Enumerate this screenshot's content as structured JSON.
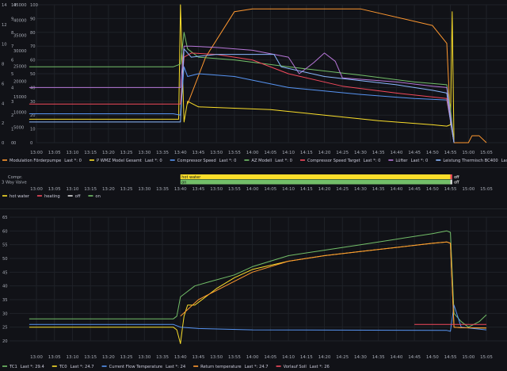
{
  "chart_data": [
    {
      "type": "line",
      "panel": "heat-pump-power-modulation",
      "time_ticks": [
        "13:00",
        "13:05",
        "13:10",
        "13:15",
        "13:20",
        "13:25",
        "13:30",
        "13:35",
        "13:40",
        "13:45",
        "13:50",
        "13:55",
        "14:00",
        "14:05",
        "14:10",
        "14:15",
        "14:20",
        "14:25",
        "14:30",
        "14:35",
        "14:40",
        "14:45",
        "14:50",
        "14:55",
        "15:00",
        "15:05"
      ],
      "y_axes": [
        {
          "ticks": [
            0,
            2,
            4,
            6,
            8,
            10,
            12,
            14
          ]
        },
        {
          "ticks": [
            0,
            1,
            2,
            3,
            4,
            5,
            6,
            7,
            8,
            9,
            10
          ]
        },
        {
          "ticks": [
            0,
            5000,
            10000,
            15000,
            20000,
            25000,
            30000,
            35000,
            40000,
            45000
          ]
        },
        {
          "ticks": [
            0,
            10,
            20,
            30,
            40,
            50,
            60,
            70,
            80,
            90,
            100
          ]
        }
      ],
      "y_axis_labels": [
        [
          "0",
          "2",
          "4",
          "6",
          "8",
          "10",
          "12",
          "14"
        ],
        [
          "0",
          "1",
          "2",
          "3",
          "4",
          "5",
          "6",
          "7",
          "8",
          "9",
          "10"
        ],
        [
          "0",
          "5000",
          "10000",
          "15000",
          "20000",
          "25000",
          "30000",
          "35000",
          "40000",
          "45000"
        ],
        [
          "0",
          "10",
          "20",
          "30",
          "40",
          "50",
          "60",
          "70",
          "80",
          "90",
          "100"
        ]
      ],
      "plot_y_max": 100,
      "legend_placement": "bottom",
      "series": [
        {
          "name": "Modulation Förderpumpe",
          "last": "Last *: 0",
          "color": "#ff9830",
          "x": [
            "12:58",
            "13:40",
            "13:42",
            "13:47",
            "13:55",
            "14:00",
            "14:30",
            "14:50",
            "14:54",
            "14:55",
            "14:56",
            "15:00",
            "15:01",
            "15:03",
            "15:05"
          ],
          "y": [
            null,
            null,
            28,
            62,
            95,
            97,
            97,
            85,
            72,
            15,
            0,
            0,
            5,
            5,
            0
          ]
        },
        {
          "name": "P WMZ Model Gesamt",
          "last": "Last *: 0",
          "color": "#fade2a",
          "x": [
            "12:58",
            "13:38",
            "13:39.5",
            "13:40",
            "13:41",
            "13:42",
            "13:45",
            "13:55",
            "14:05",
            "14:20",
            "14:35",
            "14:50",
            "14:54",
            "14:55",
            "14:55.5",
            "14:56"
          ],
          "y": [
            17,
            17,
            17,
            100,
            15,
            30,
            26,
            25,
            24,
            20,
            16,
            13,
            12,
            13,
            95,
            0
          ]
        },
        {
          "name": "Compressor Speed",
          "last": "Last *: 0",
          "color": "#5794f2",
          "x": [
            "12:58",
            "13:38",
            "13:40",
            "13:41",
            "13:42",
            "13:45",
            "13:55",
            "14:10",
            "14:30",
            "14:45",
            "14:54",
            "14:55",
            "14:56"
          ],
          "y": [
            21,
            21,
            20,
            55,
            48,
            50,
            48,
            40,
            35,
            32,
            31,
            16,
            0
          ]
        },
        {
          "name": "AZ Modell",
          "last": "Last *: 0",
          "color": "#73bf69",
          "x": [
            "12:58",
            "13:38",
            "13:40",
            "13:41",
            "13:42",
            "13:45",
            "13:55",
            "14:10",
            "14:30",
            "14:45",
            "14:54",
            "14:55",
            "14:56"
          ],
          "y": [
            55,
            55,
            57,
            80,
            68,
            62,
            60,
            55,
            49,
            44,
            42,
            25,
            0
          ]
        },
        {
          "name": "Compressor Speed Target",
          "last": "Last *: 0",
          "color": "#f2495c",
          "x": [
            "12:58",
            "13:38",
            "13:40",
            "13:41",
            "13:43",
            "13:50",
            "14:00",
            "14:10",
            "14:25",
            "14:40",
            "14:54",
            "14:55",
            "14:56"
          ],
          "y": [
            28,
            28,
            28,
            62,
            65,
            64,
            60,
            50,
            41,
            36,
            32,
            16,
            0
          ]
        },
        {
          "name": "Lüfter",
          "last": "Last *: 0",
          "color": "#b877d9",
          "x": [
            "12:58",
            "13:38",
            "13:40",
            "13:41",
            "13:43",
            "13:50",
            "14:00",
            "14:10",
            "14:13",
            "14:17",
            "14:20",
            "14:23",
            "14:25",
            "14:40",
            "14:50",
            "14:54",
            "14:55",
            "14:56"
          ],
          "y": [
            40,
            40,
            40,
            70,
            70,
            69,
            67,
            62,
            50,
            58,
            65,
            59,
            47,
            44,
            41,
            40,
            20,
            0
          ]
        },
        {
          "name": "Leistung Thermisch BC400",
          "last": "Last *: 0",
          "color": "#8ab8ff",
          "x": [
            "12:58",
            "13:38",
            "13:40",
            "13:41",
            "13:43",
            "13:50",
            "14:00",
            "14:06",
            "14:08",
            "14:20",
            "14:40",
            "14:50",
            "14:54",
            "14:55",
            "14:56"
          ],
          "y": [
            15,
            15,
            15,
            68,
            62,
            64,
            64,
            64,
            55,
            48,
            42,
            38,
            36,
            16,
            0
          ]
        }
      ]
    },
    {
      "type": "state-timeline",
      "panel": "compressor-valve",
      "time_ticks": [
        "13:00",
        "13:05",
        "13:10",
        "13:15",
        "13:20",
        "13:25",
        "13:30",
        "13:35",
        "13:40",
        "13:45",
        "13:50",
        "13:55",
        "14:00",
        "14:05",
        "14:10",
        "14:15",
        "14:20",
        "14:25",
        "14:30",
        "14:35",
        "14:40",
        "14:45",
        "14:50",
        "14:55",
        "15:00",
        "15:05"
      ],
      "rows": [
        {
          "name": "Compr.",
          "segments": [
            {
              "from": "13:40",
              "to": "14:55",
              "label": "hot water",
              "color": "#fade2a"
            },
            {
              "from": "14:55",
              "to": "14:55.5",
              "label": "",
              "color": "#f2495c"
            }
          ],
          "end_label": "off"
        },
        {
          "name": "3 Way Valve",
          "segments": [
            {
              "from": "13:40",
              "to": "14:55",
              "label": "on",
              "color": "#73bf69"
            },
            {
              "from": "14:55",
              "to": "14:55.5",
              "label": "",
              "color": "#e0e0e0"
            }
          ],
          "end_label": "off"
        }
      ],
      "legend": [
        {
          "name": "hot water",
          "color": "#fade2a"
        },
        {
          "name": "heating",
          "color": "#f2495c"
        },
        {
          "name": "off",
          "color": "#e0e0e0"
        },
        {
          "name": "on",
          "color": "#73bf69"
        }
      ]
    },
    {
      "type": "line",
      "panel": "temperatures",
      "time_ticks": [
        "13:00",
        "13:05",
        "13:10",
        "13:15",
        "13:20",
        "13:25",
        "13:30",
        "13:35",
        "13:40",
        "13:45",
        "13:50",
        "13:55",
        "14:00",
        "14:05",
        "14:10",
        "14:15",
        "14:20",
        "14:25",
        "14:30",
        "14:35",
        "14:40",
        "14:45",
        "14:50",
        "14:55",
        "15:00",
        "15:05"
      ],
      "ylim": [
        20,
        65
      ],
      "y_ticks": [
        20,
        25,
        30,
        35,
        40,
        45,
        50,
        55,
        60,
        65
      ],
      "y_tick_labels": [
        "20",
        "25",
        "30",
        "35",
        "40",
        "45",
        "50",
        "55",
        "60",
        "65"
      ],
      "legend_placement": "bottom",
      "series": [
        {
          "name": "TC1",
          "last": "Last *: 29.4",
          "color": "#73bf69",
          "x": [
            "12:58",
            "13:38",
            "13:39",
            "13:40",
            "13:42",
            "13:44",
            "13:48",
            "13:55",
            "14:00",
            "14:10",
            "14:20",
            "14:30",
            "14:40",
            "14:50",
            "14:54",
            "14:55",
            "14:56",
            "14:58",
            "15:00",
            "15:03",
            "15:05"
          ],
          "y": [
            28,
            28,
            29,
            36,
            38,
            40,
            41.5,
            44,
            47,
            51,
            53,
            55,
            57,
            59,
            60,
            59.5,
            30,
            27,
            25,
            27,
            29.5
          ]
        },
        {
          "name": "TC0",
          "last": "Last *: 24.7",
          "color": "#fade2a",
          "x": [
            "12:58",
            "13:38",
            "13:39",
            "13:40",
            "13:40.5",
            "13:41",
            "13:42",
            "13:44",
            "13:47",
            "13:50",
            "13:55",
            "14:00",
            "14:10",
            "14:20",
            "14:30",
            "14:40",
            "14:50",
            "14:54",
            "14:55",
            "14:56",
            "14:58",
            "15:05"
          ],
          "y": [
            25,
            25,
            24,
            19,
            24,
            29,
            33,
            33,
            36,
            39,
            43,
            46,
            49,
            51,
            52.5,
            54,
            55.5,
            56,
            55.5,
            25,
            24.8,
            24.7
          ]
        },
        {
          "name": "Current Flow Temperature",
          "last": "Last *: 24",
          "color": "#5794f2",
          "x": [
            "12:58",
            "13:38",
            "13:40",
            "13:45",
            "14:00",
            "14:54",
            "14:55",
            "14:56",
            "14:58",
            "15:05"
          ],
          "y": [
            26,
            26,
            25,
            24.5,
            24,
            23.8,
            23.5,
            33,
            25,
            24
          ]
        },
        {
          "name": "Return temperature",
          "last": "Last *: 24.7",
          "color": "#ff9830",
          "x": [
            "12:58",
            "13:38",
            "13:40",
            "13:45",
            "14:00",
            "14:10",
            "14:20",
            "14:30",
            "14:40",
            "14:50",
            "14:54",
            "14:55",
            "14:56",
            "14:58",
            "15:05"
          ],
          "y": [
            null,
            null,
            29,
            35,
            45,
            49,
            51,
            52.5,
            54,
            55.5,
            56,
            55.5,
            25,
            24.8,
            24.7
          ]
        },
        {
          "name": "Vorlauf Soll",
          "last": "Last *: 26",
          "color": "#f2495c",
          "x": [
            "14:45",
            "14:55",
            "14:55.5",
            "15:05"
          ],
          "y": [
            26,
            26,
            26,
            26
          ]
        }
      ]
    }
  ]
}
